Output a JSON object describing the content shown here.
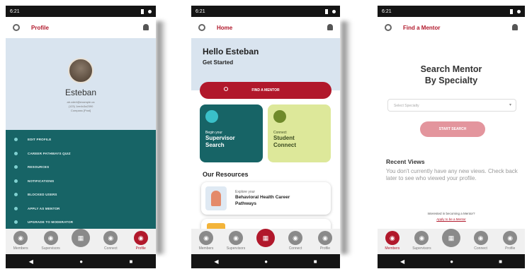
{
  "status_bar": {
    "time": "6:21"
  },
  "bottom_nav": [
    {
      "label": "Members",
      "icon": "members-icon",
      "glyph": "◉"
    },
    {
      "label": "Supervisors",
      "icon": "supervisors-icon",
      "glyph": "◉"
    },
    {
      "label": "",
      "icon": "home-grid-icon",
      "glyph": "▦"
    },
    {
      "label": "Connect",
      "icon": "connect-icon",
      "glyph": "◉"
    },
    {
      "label": "Profile",
      "icon": "profile-icon",
      "glyph": "◉"
    }
  ],
  "profile_screen": {
    "title": "Profile",
    "name": "Esteban",
    "info_line1": "ab.cdert@example.ca",
    "info_line2": "(123) 1ee4x3a2390",
    "info_line3": "Compass [Post]",
    "menu": [
      "EDIT PROFILE",
      "CAREER PATHWAYS QUIZ",
      "RESOURCES",
      "NOTIFICATIONS",
      "BLOCKED USERS",
      "APPLY AS MENTOR",
      "UPGRADE TO MODERATOR"
    ]
  },
  "home_screen": {
    "title": "Home",
    "greeting": "Hello Esteban",
    "subtitle": "Get Started",
    "find_button": "FIND A MENTOR",
    "card_left": {
      "small": "Begin your",
      "line1": "Supervisor",
      "line2": "Search"
    },
    "card_right": {
      "small": "Connect",
      "line1": "Student",
      "line2": "Connect"
    },
    "resources_title": "Our Resources",
    "resource": {
      "small": "Explore your",
      "line1": "Behavioral Health Career",
      "line2": "Pathways"
    }
  },
  "mentor_screen": {
    "title": "Find a Mentor",
    "heading_line1": "Search Mentor",
    "heading_line2": "By Specialty",
    "specialty_placeholder": "Select Specialty",
    "start_button": "START SEARCH",
    "recent_title": "Recent Views",
    "recent_text": "You don't currently have any new views. Check back later to see who viewed your profile.",
    "mentor_question": "Interested in becoming a Mentor?",
    "mentor_link": "Apply to be a Mentor"
  },
  "colors": {
    "brand_red": "#b1182b",
    "teal": "#176466",
    "light_blue": "#d9e4ef",
    "lime": "#dde89a"
  }
}
